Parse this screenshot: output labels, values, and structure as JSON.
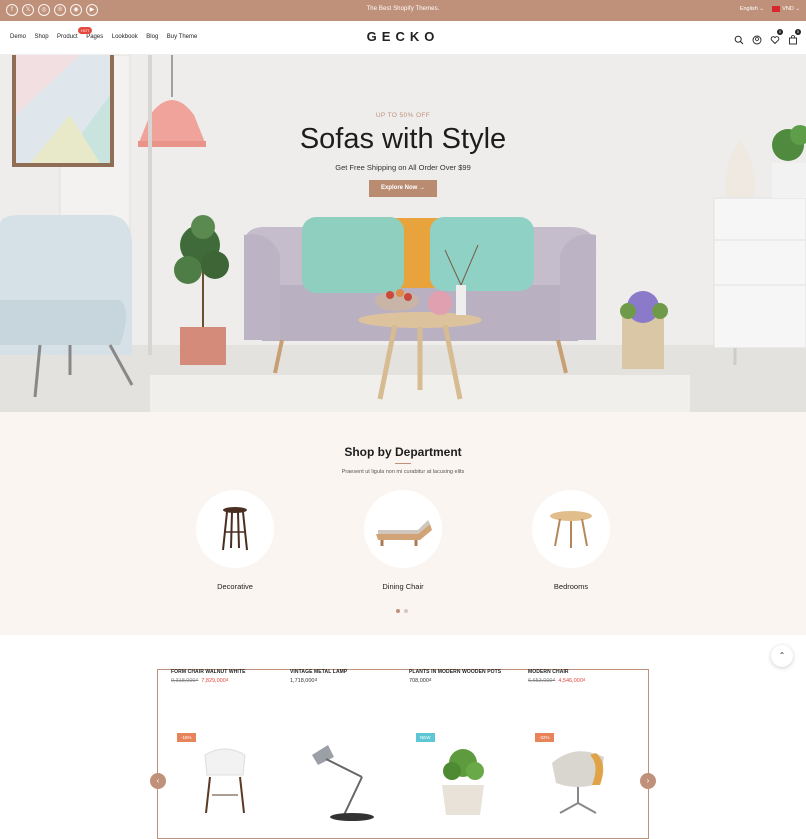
{
  "topbar": {
    "promo": "The Best Shopify Themes.",
    "language": "English ⌄",
    "currency": "VND ⌄",
    "socials": [
      "facebook-icon",
      "x-icon",
      "instagram-icon",
      "pinterest-icon",
      "dribbble-icon",
      "youtube-icon"
    ],
    "social_glyphs": [
      "f",
      "𝕏",
      "◎",
      "℗",
      "◉",
      "▶"
    ]
  },
  "nav": {
    "logo": "GECKO",
    "menu": [
      "Demo",
      "Shop",
      "Product",
      "Pages",
      "Lookbook",
      "Blog",
      "Buy Theme"
    ],
    "hot_badge": "HOT",
    "wishlist_count": "0",
    "cart_count": "0"
  },
  "hero": {
    "eyebrow": "UP TO 50% OFF",
    "title": "Sofas with Style",
    "subtitle": "Get Free Shipping on All Order Over $99",
    "cta": "Explore Now →"
  },
  "department": {
    "title": "Shop by Department",
    "description": "Praesent ut ligula non mi curabitur at lacusing elits",
    "categories": [
      {
        "label": "Decorative",
        "icon": "stool-icon"
      },
      {
        "label": "Dining Chair",
        "icon": "lounger-icon"
      },
      {
        "label": "Bedrooms",
        "icon": "table-icon"
      }
    ],
    "active_page": 1,
    "page_count": 2
  },
  "products": [
    {
      "name": "FORM CHAIR WALNUT WHITE",
      "old_price": "9,318,000₫",
      "price": "7,829,000₫",
      "badge": "-15%",
      "badge_color": "#e8845a"
    },
    {
      "name": "VINTAGE METAL LAMP",
      "old_price": "",
      "price": "1,718,000₫",
      "badge": "",
      "badge_color": ""
    },
    {
      "name": "PLANTS IN MODERN WOODEN POTS",
      "old_price": "",
      "price": "708,000₫",
      "badge": "NEW",
      "badge_color": "#5ec7d6"
    },
    {
      "name": "MODERN CHAIR",
      "old_price": "6,653,000₫",
      "price": "4,546,000₫",
      "badge": "-32%",
      "badge_color": "#e8845a"
    }
  ],
  "carousel": {
    "prev": "‹",
    "next": "›",
    "to_top": "⌃"
  },
  "colors": {
    "accent": "#c0917a",
    "sale": "#e4483e",
    "bg_soft": "#fbf5f1"
  }
}
